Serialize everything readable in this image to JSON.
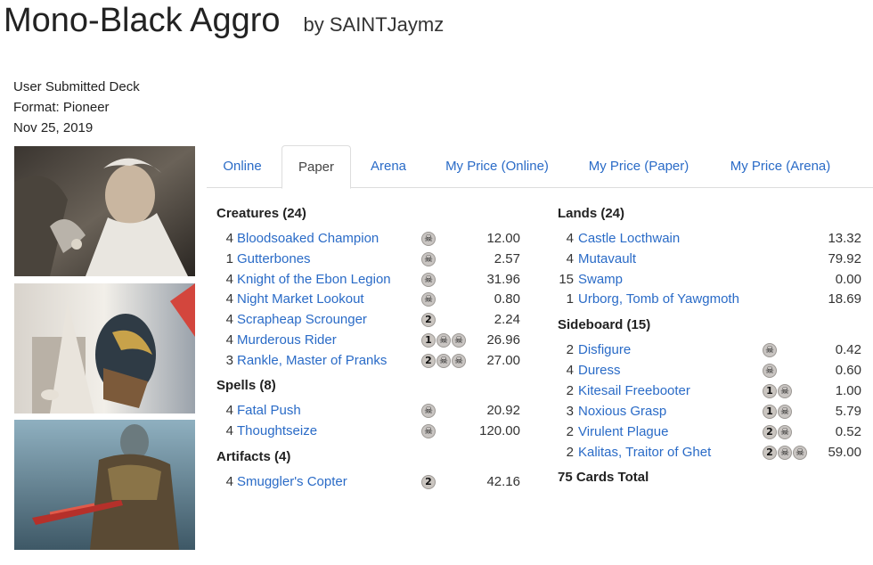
{
  "deck": {
    "title": "Mono-Black Aggro",
    "author": "by SAINTJaymz",
    "submitted": "User Submitted Deck",
    "format": "Format: Pioneer",
    "date": "Nov 25, 2019"
  },
  "tabs": [
    "Online",
    "Paper",
    "Arena",
    "My Price (Online)",
    "My Price (Paper)",
    "My Price (Arena)"
  ],
  "active_tab": "Paper",
  "sections": {
    "creatures": {
      "title": "Creatures (24)",
      "cards": [
        {
          "qty": "4",
          "name": "Bloodsoaked Champion",
          "cost": [
            "B"
          ],
          "price": "12.00"
        },
        {
          "qty": "1",
          "name": "Gutterbones",
          "cost": [
            "B"
          ],
          "price": "2.57"
        },
        {
          "qty": "4",
          "name": "Knight of the Ebon Legion",
          "cost": [
            "B"
          ],
          "price": "31.96"
        },
        {
          "qty": "4",
          "name": "Night Market Lookout",
          "cost": [
            "B"
          ],
          "price": "0.80"
        },
        {
          "qty": "4",
          "name": "Scrapheap Scrounger",
          "cost": [
            "2"
          ],
          "price": "2.24"
        },
        {
          "qty": "4",
          "name": "Murderous Rider",
          "cost": [
            "1",
            "B",
            "B"
          ],
          "price": "26.96"
        },
        {
          "qty": "3",
          "name": "Rankle, Master of Pranks",
          "cost": [
            "2",
            "B",
            "B"
          ],
          "price": "27.00"
        }
      ]
    },
    "spells": {
      "title": "Spells (8)",
      "cards": [
        {
          "qty": "4",
          "name": "Fatal Push",
          "cost": [
            "B"
          ],
          "price": "20.92"
        },
        {
          "qty": "4",
          "name": "Thoughtseize",
          "cost": [
            "B"
          ],
          "price": "120.00"
        }
      ]
    },
    "artifacts": {
      "title": "Artifacts (4)",
      "cards": [
        {
          "qty": "4",
          "name": "Smuggler's Copter",
          "cost": [
            "2"
          ],
          "price": "42.16"
        }
      ]
    },
    "lands": {
      "title": "Lands (24)",
      "cards": [
        {
          "qty": "4",
          "name": "Castle Locthwain",
          "cost": [],
          "price": "13.32"
        },
        {
          "qty": "4",
          "name": "Mutavault",
          "cost": [],
          "price": "79.92"
        },
        {
          "qty": "15",
          "name": "Swamp",
          "cost": [],
          "price": "0.00"
        },
        {
          "qty": "1",
          "name": "Urborg, Tomb of Yawgmoth",
          "cost": [],
          "price": "18.69"
        }
      ]
    },
    "sideboard": {
      "title": "Sideboard (15)",
      "cards": [
        {
          "qty": "2",
          "name": "Disfigure",
          "cost": [
            "B"
          ],
          "price": "0.42"
        },
        {
          "qty": "4",
          "name": "Duress",
          "cost": [
            "B"
          ],
          "price": "0.60"
        },
        {
          "qty": "2",
          "name": "Kitesail Freebooter",
          "cost": [
            "1",
            "B"
          ],
          "price": "1.00"
        },
        {
          "qty": "3",
          "name": "Noxious Grasp",
          "cost": [
            "1",
            "B"
          ],
          "price": "5.79"
        },
        {
          "qty": "2",
          "name": "Virulent Plague",
          "cost": [
            "2",
            "B"
          ],
          "price": "0.52"
        },
        {
          "qty": "2",
          "name": "Kalitas, Traitor of Ghet",
          "cost": [
            "2",
            "B",
            "B"
          ],
          "price": "59.00"
        }
      ]
    }
  },
  "total": "75 Cards Total",
  "colors": {
    "link": "#2a6bc7",
    "text": "#222222",
    "tab_border": "#dddddd"
  }
}
